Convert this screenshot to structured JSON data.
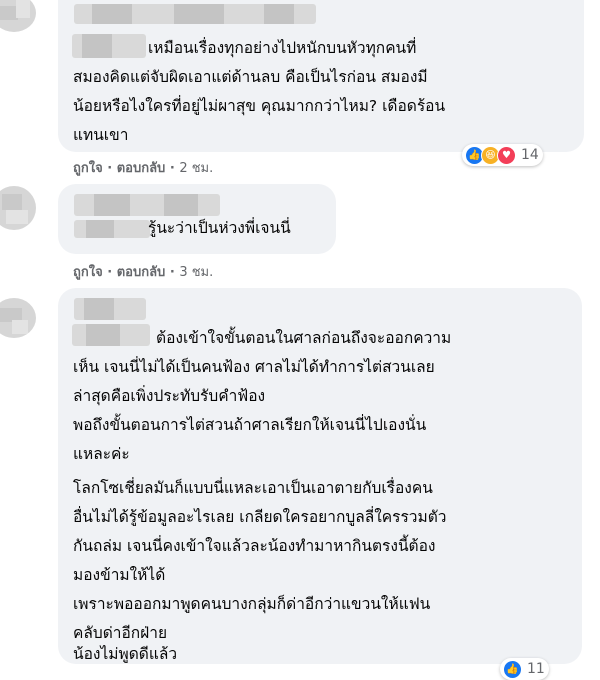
{
  "colors": {
    "bubble": "#f0f2f5",
    "meta": "#65676b",
    "like": "#1877f2",
    "haha": "#f7b125",
    "love": "#f33e58"
  },
  "comments": [
    {
      "lines": [
        "เหมือนเรื่องทุกอย่างไปหนักบนหัวทุกคนที่",
        "สมองคิดแต่จับผิดเอาแต่ด้านลบ คือเป็นไรก่อน สมองมี",
        "น้อยหรือไงใครที่อยู่ไม่ผาสุข คุณมากกว่าไหม? เดือดร้อน",
        "แทนเขา"
      ],
      "like_label": "ถูกใจ",
      "reply_label": "ตอบกลับ",
      "time": "2 ชม.",
      "reaction_icons": [
        "like-icon",
        "haha-icon",
        "love-icon"
      ],
      "reaction_count": "14"
    },
    {
      "lines": [
        "รู้นะว่าเป็นห่วงพี่เจนนี่"
      ],
      "like_label": "ถูกใจ",
      "reply_label": "ตอบกลับ",
      "time": "3 ชม."
    },
    {
      "lines": [
        "ต้องเข้าใจขั้นตอนในศาลก่อนถึงจะออกความ",
        "เห็น เจนนี่ไม่ได้เป็นคนฟ้อง ศาลไม่ได้ทำการไต่สวนเลย",
        "ล่าสุดคือเพิ่งประทับรับคำฟ้อง",
        "พอถึงขั้นตอนการไต่สวนถ้าศาลเรียกให้เจนนี่ไปเองนั่น",
        "แหละค่ะ",
        "โลกโซเชี่ยลมันก็แบบนี่แหละเอาเป็นเอาตายกับเรื่องคน",
        "อื่นไม่ได้รู้ข้อมูลอะไรเลย เกลียดใครอยากบูลลี่ใครรวมตัว",
        "กันถล่ม เจนนี่คงเข้าใจแล้วละน้องทำมาหากินตรงนี้ต้อง",
        "มองข้ามให้ได้",
        "เพราะพอออกมาพูดคนบางกลุ่มก็ด่าอีกว่าแขวนให้แฟน",
        "คลับด่าอีกฝ่าย",
        "น้องไม่พูดดีแล้ว"
      ],
      "reaction_icons": [
        "like-icon"
      ],
      "reaction_count": "11"
    }
  ]
}
